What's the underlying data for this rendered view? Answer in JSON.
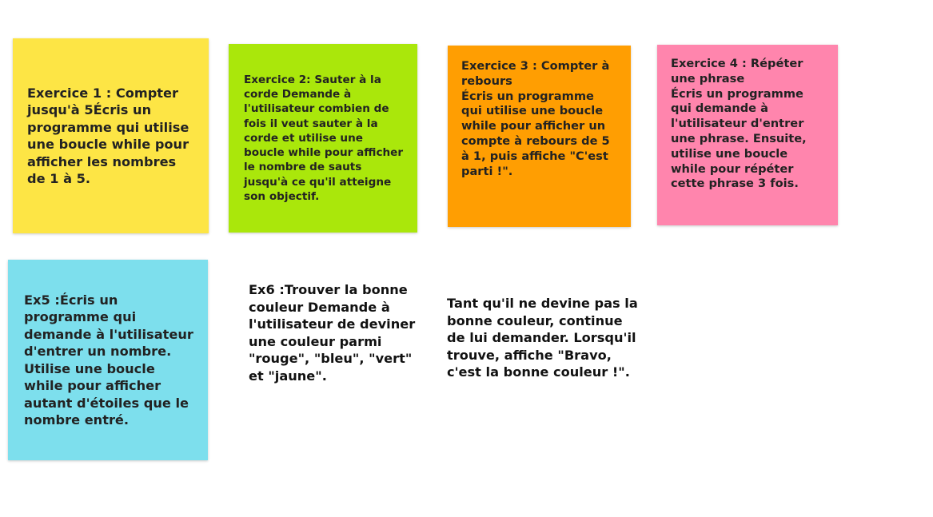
{
  "notes": [
    {
      "text": "Exercice 1 : Compter jusqu'à 5Écris un programme qui utilise une boucle while pour afficher les nombres de 1 à 5.",
      "color": "#fde545"
    },
    {
      "text": "Exercice 2: Sauter à la corde    Demande à l'utilisateur combien de fois il veut sauter à la corde et utilise une boucle while pour afficher le nombre de sauts jusqu'à ce qu'il atteigne son objectif.",
      "color": "#aae70b"
    },
    {
      "text": "Exercice 3 : Compter à rebours\nÉcris un programme qui utilise une boucle while pour afficher un compte à rebours de 5 à 1, puis affiche \"C'est parti !\".",
      "color": "#ff9e02"
    },
    {
      "text": "Exercice 4 : Répéter une phrase\nÉcris un programme qui demande à l'utilisateur d'entrer une phrase. Ensuite, utilise une boucle while pour répéter cette phrase 3 fois.",
      "color": "#ff85ad"
    },
    {
      "text": "Ex5 :Écris un programme qui demande à l'utilisateur d'entrer un nombre. Utilise une boucle while pour afficher autant d'étoiles que le nombre entré.",
      "color": "#7ddfed"
    }
  ],
  "text_blocks": [
    {
      "text": "Ex6 :Trouver la bonne couleur Demande à l'utilisateur de deviner une couleur parmi \"rouge\", \"bleu\", \"vert\" et \"jaune\"."
    },
    {
      "text": "Tant qu'il ne devine pas la bonne couleur, continue de lui demander. Lorsqu'il trouve, affiche \"Bravo, c'est la bonne couleur !\"."
    }
  ]
}
